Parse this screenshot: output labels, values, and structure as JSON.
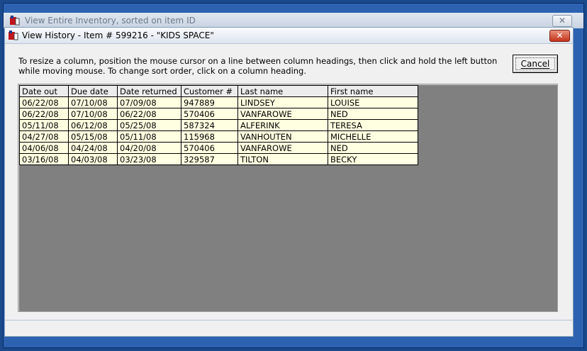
{
  "outer_window": {
    "title": "View Entire Inventory, sorted on item ID",
    "close_glyph": "✕"
  },
  "dialog": {
    "title": "View History - Item # 599216 - \"KIDS SPACE\"",
    "close_glyph": "✕",
    "instructions": "To resize a column, position the mouse cursor on a line between column headings, then click and hold the left button\nwhile moving mouse.  To change sort order, click on a column heading.",
    "cancel_label": "Cancel"
  },
  "table": {
    "headers": [
      "Date out",
      "Due date",
      "Date returned",
      "Customer #",
      "Last name",
      "First name"
    ],
    "rows": [
      [
        "06/22/08",
        "07/10/08",
        "07/09/08",
        "947889",
        "LINDSEY",
        "LOUISE"
      ],
      [
        "06/22/08",
        "07/10/08",
        "06/22/08",
        "570406",
        "VANFAROWE",
        "NED"
      ],
      [
        "05/11/08",
        "06/12/08",
        "05/25/08",
        "587324",
        "ALFERINK",
        "TERESA"
      ],
      [
        "04/27/08",
        "05/15/08",
        "05/11/08",
        "115968",
        "VANHOUTEN",
        "MICHELLE"
      ],
      [
        "04/06/08",
        "04/24/08",
        "04/20/08",
        "570406",
        "VANFAROWE",
        "NED"
      ],
      [
        "03/16/08",
        "04/03/08",
        "03/23/08",
        "329587",
        "TILTON",
        "BECKY"
      ]
    ]
  },
  "colors": {
    "grid_background": "#808080",
    "row_background": "#ffffe1",
    "close_button": "#c4341b"
  }
}
